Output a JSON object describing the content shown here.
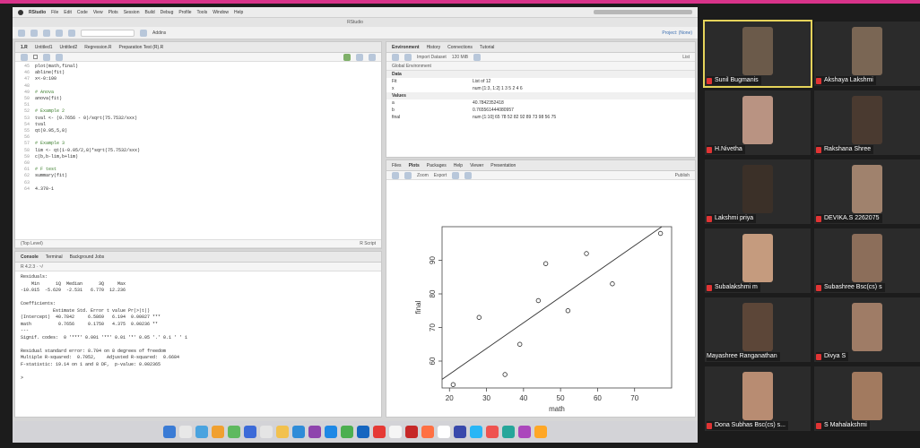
{
  "menubar": {
    "app": "RStudio",
    "items": [
      "File",
      "Edit",
      "Code",
      "View",
      "Plots",
      "Session",
      "Build",
      "Debug",
      "Profile",
      "Tools",
      "Window",
      "Help"
    ]
  },
  "window_title": "RStudio",
  "toolbar": {
    "addins": "Addins",
    "project": "Project: (None)"
  },
  "source": {
    "tabs": [
      "1.R",
      "Untitled1",
      "Untitled2",
      "Regression.R",
      "Preparation Test (R).R"
    ],
    "lines": [
      {
        "n": "45",
        "t": "plot(math,final)",
        "c": false
      },
      {
        "n": "46",
        "t": "abline(fit)",
        "c": false
      },
      {
        "n": "47",
        "t": "x<-0:100",
        "c": false
      },
      {
        "n": "48",
        "t": "",
        "c": false
      },
      {
        "n": "49",
        "t": "# Anova",
        "c": true
      },
      {
        "n": "50",
        "t": "anova(fit)",
        "c": false
      },
      {
        "n": "51",
        "t": "",
        "c": false
      },
      {
        "n": "52",
        "t": "# Example 2",
        "c": true
      },
      {
        "n": "53",
        "t": "tval <- (0.7656 - 0)/sqrt(75.7532/sxx)",
        "c": false
      },
      {
        "n": "54",
        "t": "tval",
        "c": false
      },
      {
        "n": "55",
        "t": "qt(0.95,5,8)",
        "c": false
      },
      {
        "n": "56",
        "t": "",
        "c": false
      },
      {
        "n": "57",
        "t": "# Example 3",
        "c": true
      },
      {
        "n": "58",
        "t": "lim <- qt(1-0.05/2,8)*sqrt(75.7532/sxx)",
        "c": false
      },
      {
        "n": "59",
        "t": "c(b,b-lim,b+lim)",
        "c": false
      },
      {
        "n": "60",
        "t": "",
        "c": false
      },
      {
        "n": "61",
        "t": "# F test",
        "c": true
      },
      {
        "n": "62",
        "t": "summary(fit)",
        "c": false
      },
      {
        "n": "63",
        "t": "",
        "c": false
      },
      {
        "n": "64",
        "t": "4.370-1",
        "c": false
      }
    ],
    "status": "(Top Level)",
    "filetype": "R Script"
  },
  "console": {
    "tabs": [
      "Console",
      "Terminal",
      "Background Jobs"
    ],
    "path": "R 4.2.3 · ~/",
    "output": "Residuals:\n    Min      1Q  Median      3Q     Max \n-10.015  -5.629  -2.531   6.770  12.236 \n\nCoefficients:\n            Estimate Std. Error t value Pr(>|t|)   \n(Intercept)  40.7842     6.5869   6.194  0.00027 ***\nmath          0.7656     0.1750   4.375  0.00236 ** \n---\nSignif. codes:  0 '***' 0.001 '**' 0.01 '*' 0.05 '.' 0.1 ' ' 1\n\nResidual standard error: 8.704 on 8 degrees of freedom\nMultiple R-squared:  0.7052,\tAdjusted R-squared:  0.6684 \nF-statistic: 19.14 on 1 and 8 DF,  p-value: 0.002365\n\n>"
  },
  "environment": {
    "tabs": [
      "Environment",
      "History",
      "Connections",
      "Tutorial"
    ],
    "import_label": "Import Dataset",
    "memory": "120 MiB",
    "scope": "Global Environment",
    "list_label": "List",
    "sections": [
      {
        "title": "Data",
        "rows": [
          {
            "k": "Fit",
            "v": "List of 12"
          },
          {
            "k": "x",
            "v": "num [1:3, 1:2] 1 3 5 2 4 6"
          }
        ]
      },
      {
        "title": "Values",
        "rows": [
          {
            "k": "a",
            "v": "40.7842352418"
          },
          {
            "k": "b",
            "v": "0.765561444080957"
          },
          {
            "k": "final",
            "v": "num [1:10] 65 78 52 82 92 89 73 98 56 75"
          }
        ]
      }
    ]
  },
  "plots": {
    "tabs": [
      "Files",
      "Plots",
      "Packages",
      "Help",
      "Viewer",
      "Presentation"
    ],
    "zoom": "Zoom",
    "export": "Export",
    "publish": "Publish"
  },
  "chart_data": {
    "type": "scatter",
    "xlabel": "math",
    "ylabel": "final",
    "xlim": [
      18,
      80
    ],
    "ylim": [
      52,
      100
    ],
    "xticks": [
      20,
      30,
      40,
      50,
      60,
      70
    ],
    "yticks": [
      60,
      70,
      80,
      90
    ],
    "x": [
      21,
      28,
      35,
      39,
      44,
      46,
      52,
      57,
      64,
      77
    ],
    "y": [
      53,
      73,
      56,
      65,
      78,
      89,
      75,
      92,
      83,
      98
    ],
    "fit_line": {
      "intercept": 40.78,
      "slope": 0.7656
    }
  },
  "participants": [
    {
      "name": "Sunil Bugmanis",
      "muted": true,
      "highlight": true,
      "color": "#6b5a4a"
    },
    {
      "name": "Akshaya Lakshmi",
      "muted": true,
      "highlight": false,
      "color": "#7a6654"
    },
    {
      "name": "H.Nivetha",
      "muted": true,
      "highlight": false,
      "color": "#b99382"
    },
    {
      "name": "Rakshana Shree",
      "muted": true,
      "highlight": false,
      "color": "#4a3a30"
    },
    {
      "name": "Lakshmi priya",
      "muted": true,
      "highlight": false,
      "color": "#3b3028"
    },
    {
      "name": "DEVIKA.S 2262075",
      "muted": true,
      "highlight": false,
      "color": "#a0826d"
    },
    {
      "name": "Subalakshmi m",
      "muted": true,
      "highlight": false,
      "color": "#c59b7e"
    },
    {
      "name": "Subashree Bsc(cs) s",
      "muted": true,
      "highlight": false,
      "color": "#8c6e5a"
    },
    {
      "name": "Mayashree Ranganathan",
      "muted": false,
      "highlight": false,
      "color": "#5c4638"
    },
    {
      "name": "Divya S",
      "muted": true,
      "highlight": false,
      "color": "#9f7c66"
    },
    {
      "name": "Dona Subhas Bsc(cs) s...",
      "muted": true,
      "highlight": false,
      "color": "#b88c72"
    },
    {
      "name": "S Mahalakshmi",
      "muted": true,
      "highlight": false,
      "color": "#a27a5f"
    }
  ],
  "dock": {
    "colors": [
      "#3a7bd5",
      "#e8e8e8",
      "#4aa3df",
      "#f0a030",
      "#5fb95f",
      "#3c6ad8",
      "#e5e5e5",
      "#f2c14e",
      "#2f8cd8",
      "#8e44ad",
      "#1e88e5",
      "#4caf50",
      "#1565c0",
      "#e53935",
      "#f5f5f5",
      "#c62828",
      "#ff7043",
      "#ffffff",
      "#3949ab",
      "#29b6f6",
      "#ef5350",
      "#26a69a",
      "#ab47bc",
      "#ffa726"
    ]
  }
}
